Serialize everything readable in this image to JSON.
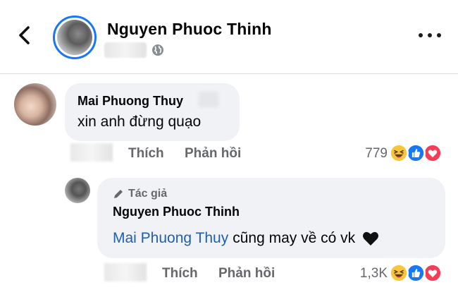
{
  "header": {
    "name": "Nguyen Phuoc Thinh",
    "back_icon": "chevron-left-icon",
    "more_icon": "more-horizontal-icon",
    "privacy_icon": "globe-icon"
  },
  "comments": [
    {
      "author": "Mai Phuong Thuy",
      "text": "xin anh đừng quạo",
      "actions": {
        "like": "Thích",
        "reply": "Phản hồi"
      },
      "reaction_count": "779",
      "reactions": [
        "haha",
        "like",
        "love"
      ]
    }
  ],
  "reply": {
    "author_badge": "Tác giả",
    "author": "Nguyen Phuoc Thinh",
    "mention": "Mai Phuong Thuy",
    "text": "cũng may về có vk",
    "actions": {
      "like": "Thích",
      "reply": "Phản hồi"
    },
    "reaction_count": "1,3K",
    "reactions": [
      "haha",
      "like",
      "love"
    ]
  },
  "colors": {
    "accent": "#1877f2",
    "mention": "#1f5fb4",
    "bubble": "#f0f2f5",
    "secondary_text": "#65676b"
  }
}
